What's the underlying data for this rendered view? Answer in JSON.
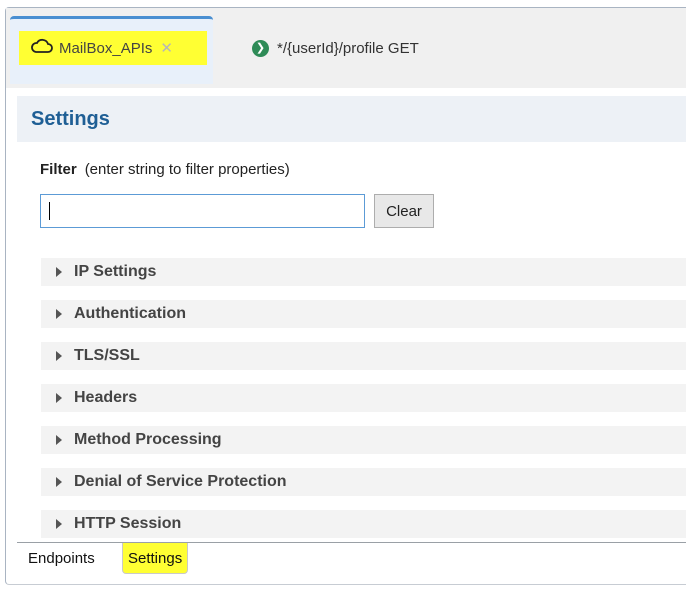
{
  "tabs": [
    {
      "label": "MailBox_APIs",
      "icon": "cloud-icon",
      "active": true,
      "highlight": "#ffff33"
    },
    {
      "label": "*/{userId}/profile GET",
      "icon": "green-arrow-circle-icon",
      "active": false
    }
  ],
  "settings": {
    "title": "Settings",
    "filter_label": "Filter",
    "filter_hint": "(enter string to filter properties)",
    "filter_value": "",
    "clear_label": "Clear"
  },
  "sections": [
    {
      "label": "IP Settings"
    },
    {
      "label": "Authentication"
    },
    {
      "label": "TLS/SSL"
    },
    {
      "label": "Headers"
    },
    {
      "label": "Method Processing"
    },
    {
      "label": "Denial of Service Protection"
    },
    {
      "label": "HTTP Session"
    }
  ],
  "bottom_tabs": [
    {
      "label": "Endpoints",
      "active": false
    },
    {
      "label": "Settings",
      "active": true,
      "highlight": "#ffff33"
    }
  ],
  "colors": {
    "accent_blue": "#1f5f95",
    "tab_top_border": "#4a8fd1",
    "highlight": "#ffff33",
    "status_green": "#2e8b57"
  }
}
